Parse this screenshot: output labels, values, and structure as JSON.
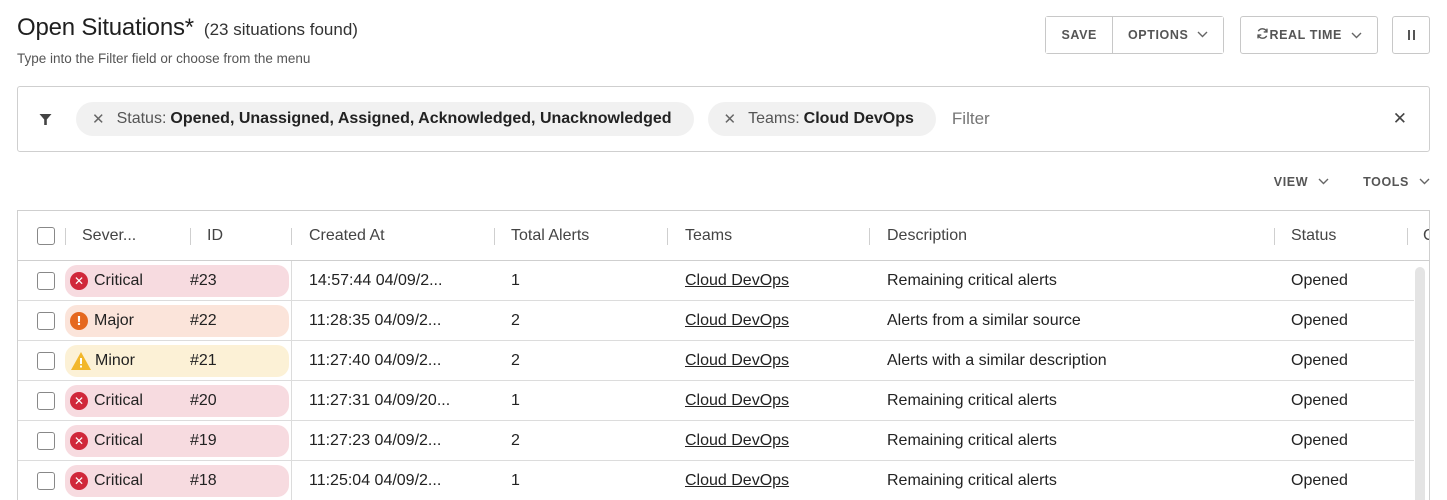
{
  "header": {
    "title": "Open Situations*",
    "count": "(23 situations found)",
    "subtitle": "Type into the Filter field or choose from the menu"
  },
  "actions": {
    "save": "SAVE",
    "options": "OPTIONS",
    "realtime": "REAL TIME"
  },
  "filter": {
    "chips": [
      {
        "key": "Status:",
        "value": "Opened, Unassigned, Assigned, Acknowledged, Unacknowledged"
      },
      {
        "key": "Teams:",
        "value": "Cloud DevOps"
      }
    ],
    "placeholder": "Filter"
  },
  "view_tools": {
    "view": "VIEW",
    "tools": "TOOLS"
  },
  "columns": [
    "Sever...",
    "ID",
    "Created At",
    "Total Alerts",
    "Teams",
    "Description",
    "Status",
    "C"
  ],
  "severity_colors": {
    "Critical": {
      "pill": "#f7dbe0",
      "icon": "#d0283a"
    },
    "Major": {
      "pill": "#fbe4da",
      "icon": "#e5681f"
    },
    "Minor": {
      "pill": "#fcf1d6",
      "icon": "#f2b72b"
    }
  },
  "rows": [
    {
      "severity": "Critical",
      "id": "#23",
      "created": "14:57:44 04/09/2...",
      "alerts": "1",
      "team": "Cloud DevOps",
      "description": "Remaining critical alerts",
      "status": "Opened"
    },
    {
      "severity": "Major",
      "id": "#22",
      "created": "11:28:35 04/09/2...",
      "alerts": "2",
      "team": "Cloud DevOps",
      "description": "Alerts from a similar source",
      "status": "Opened"
    },
    {
      "severity": "Minor",
      "id": "#21",
      "created": "11:27:40 04/09/2...",
      "alerts": "2",
      "team": "Cloud DevOps",
      "description": "Alerts with a similar description",
      "status": "Opened"
    },
    {
      "severity": "Critical",
      "id": "#20",
      "created": "11:27:31 04/09/20...",
      "alerts": "1",
      "team": "Cloud DevOps",
      "description": "Remaining critical alerts",
      "status": "Opened"
    },
    {
      "severity": "Critical",
      "id": "#19",
      "created": "11:27:23 04/09/2...",
      "alerts": "2",
      "team": "Cloud DevOps",
      "description": "Remaining critical alerts",
      "status": "Opened"
    },
    {
      "severity": "Critical",
      "id": "#18",
      "created": "11:25:04 04/09/2...",
      "alerts": "1",
      "team": "Cloud DevOps",
      "description": "Remaining critical alerts",
      "status": "Opened"
    }
  ]
}
